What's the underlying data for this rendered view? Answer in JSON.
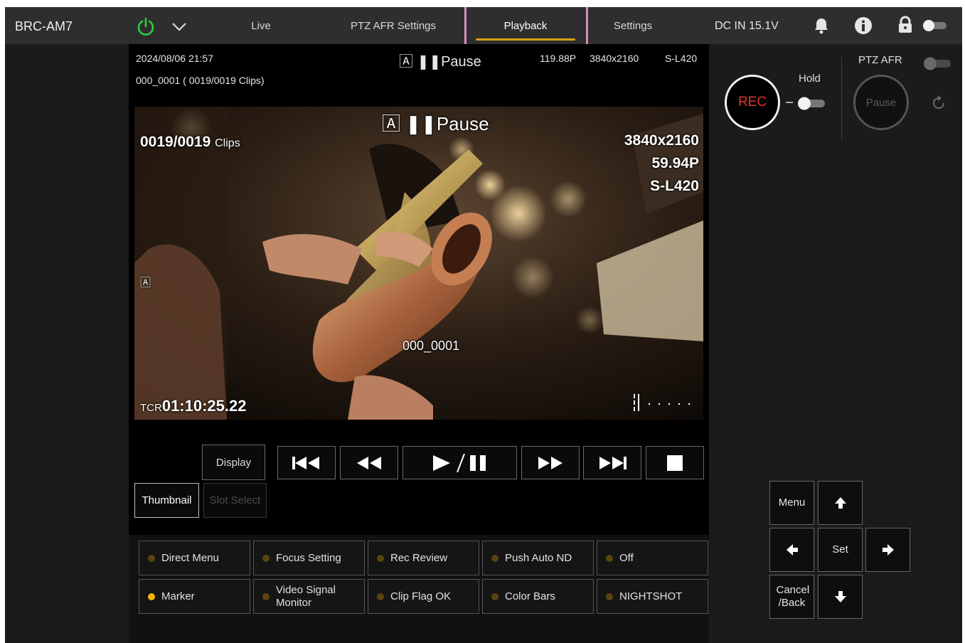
{
  "header": {
    "model": "BRC-AM7",
    "tabs": [
      {
        "label": "Live"
      },
      {
        "label": "PTZ AFR Settings"
      },
      {
        "label": "Playback"
      },
      {
        "label": "Settings"
      }
    ],
    "active_tab": "Playback",
    "power_input": "DC IN 15.1V"
  },
  "status": {
    "datetime": "2024/08/06 21:57",
    "clip_info": "000_0001 ( 0019/0019 Clips)",
    "pause_label": "Pause",
    "frame_rate": "119.88P",
    "resolution": "3840x2160",
    "codec": "S-L420"
  },
  "video": {
    "clips_count": "0019/0019",
    "clips_unit": "Clips",
    "pause_label": "Pause",
    "resolution": "3840x2160",
    "frame_rate": "59.94P",
    "codec": "S-L420",
    "clip_name": "000_0001",
    "tc_prefix": "TCR",
    "timecode": "01:10:25.22"
  },
  "transport": {
    "display_label": "Display",
    "thumbnail_label": "Thumbnail",
    "slot_select_label": "Slot Select"
  },
  "assign_buttons": [
    {
      "label": "Direct Menu",
      "active": false
    },
    {
      "label": "Focus Setting",
      "active": false
    },
    {
      "label": "Rec Review",
      "active": false
    },
    {
      "label": "Push Auto ND",
      "active": false
    },
    {
      "label": "Off",
      "active": false
    },
    {
      "label": "Marker",
      "active": true
    },
    {
      "label": "Video Signal Monitor",
      "active": false
    },
    {
      "label": "Clip Flag OK",
      "active": false
    },
    {
      "label": "Color Bars",
      "active": false
    },
    {
      "label": "NIGHTSHOT",
      "active": false
    }
  ],
  "right_panel": {
    "rec_label": "REC",
    "hold_label": "Hold",
    "ptz_afr_label": "PTZ AFR",
    "pause_label": "Pause",
    "menu_label": "Menu",
    "set_label": "Set",
    "cancel_label": "Cancel /Back"
  },
  "colors": {
    "accent_underline": "#d6a316",
    "rec_red": "#e0332e",
    "power_green": "#2ecc40",
    "active_dot": "#f5b400",
    "tab_highlight": "#d98fbf"
  }
}
